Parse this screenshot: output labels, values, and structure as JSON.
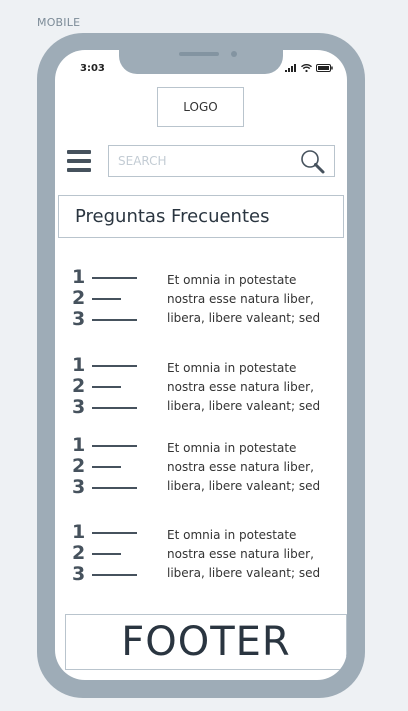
{
  "frame_label": "MOBILE",
  "status_bar": {
    "time": "3:03",
    "icons": [
      "signal-icon",
      "wifi-icon",
      "battery-icon"
    ]
  },
  "header": {
    "logo_text": "LOGO"
  },
  "search": {
    "placeholder": "SEARCH",
    "icon": "search-icon"
  },
  "menu_icon": "hamburger-menu-icon",
  "faq": {
    "title": "Preguntas Frecuentes",
    "items": [
      {
        "numbers": [
          "1",
          "2",
          "3"
        ],
        "lines": [
          "Et omnia in potestate",
          "nostra esse natura liber,",
          "libera, libere valeant; sed"
        ]
      },
      {
        "numbers": [
          "1",
          "2",
          "3"
        ],
        "lines": [
          "Et omnia in potestate",
          "nostra esse natura liber,",
          "libera, libere valeant; sed"
        ]
      },
      {
        "numbers": [
          "1",
          "2",
          "3"
        ],
        "lines": [
          "Et omnia in potestate",
          "nostra esse natura liber,",
          "libera, libere valeant; sed"
        ]
      },
      {
        "numbers": [
          "1",
          "2",
          "3"
        ],
        "lines": [
          "Et omnia in potestate",
          "nostra esse natura liber,",
          "libera, libere valeant; sed"
        ]
      }
    ]
  },
  "footer": {
    "text": "FOOTER"
  },
  "colors": {
    "frame": "#9eacb7",
    "border": "#b9c4cd",
    "dark": "#46525d",
    "background": "#eef1f4"
  }
}
